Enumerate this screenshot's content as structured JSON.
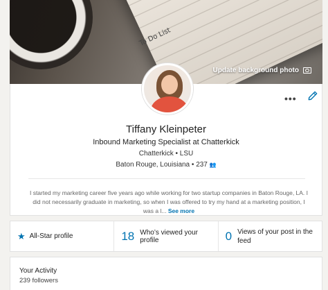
{
  "banner": {
    "notebook_text": "To Do List",
    "update_label": "Update background photo",
    "camera_icon": "camera-icon"
  },
  "profile": {
    "name": "Tiffany Kleinpeter",
    "headline": "Inbound Marketing Specialist at Chatterkick",
    "company_line": "Chatterkick • LSU",
    "location": "Baton Rouge, Louisiana",
    "connections": "237",
    "summary": "I started my marketing career five years ago while working for two startup companies in Baton Rouge, LA. I did not necessarily graduate in marketing, so when I was offered to try my hand at a marketing position, I was a l...",
    "see_more": "See more",
    "more_icon": "more-horizontal-icon",
    "edit_icon": "pencil-icon"
  },
  "stats": {
    "allstar_label": "All-Star profile",
    "views_count": "18",
    "views_label": "Who’s viewed your profile",
    "post_views_count": "0",
    "post_views_label": "Views of your post in the feed"
  },
  "activity": {
    "title": "Your Activity",
    "followers": "239 followers"
  },
  "colors": {
    "accent": "#0073b1",
    "page_bg": "#f3f2ef"
  }
}
